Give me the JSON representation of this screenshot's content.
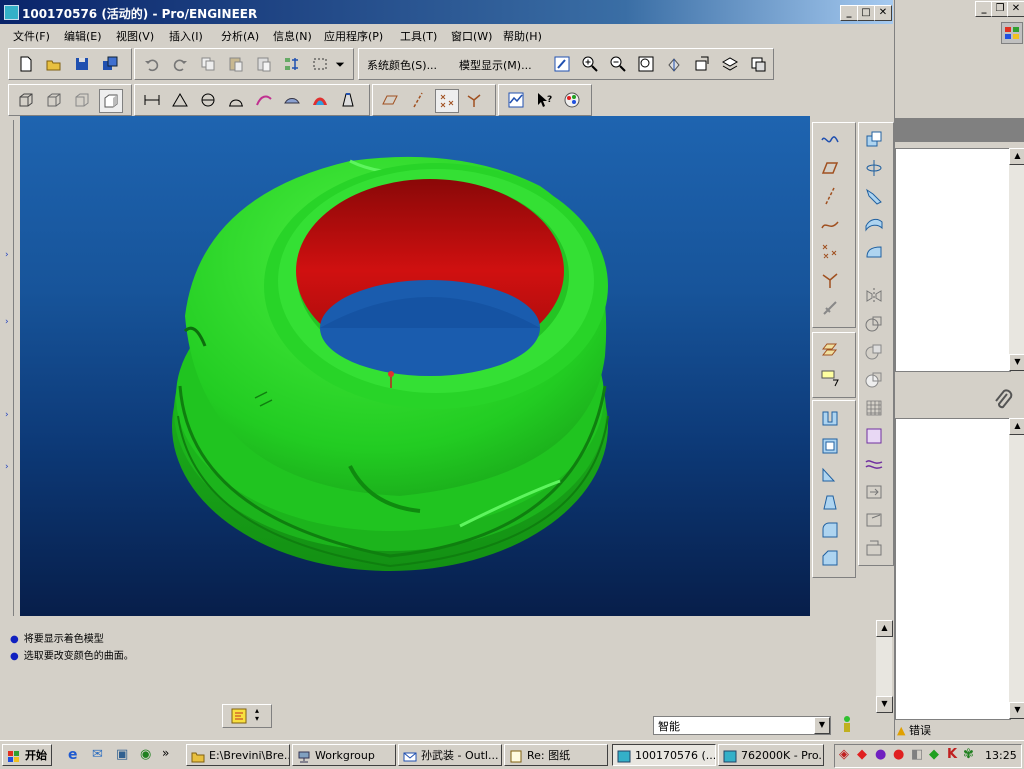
{
  "window": {
    "title": "100170576 (活动的) - Pro/ENGINEER"
  },
  "menu": [
    "文件(F)",
    "编辑(E)",
    "视图(V)",
    "插入(I)",
    "分析(A)",
    "信息(N)",
    "应用程序(P)",
    "工具(T)",
    "窗口(W)",
    "帮助(H)"
  ],
  "toolbar": {
    "system_color_label": "系统颜色(S)...",
    "model_display_label": "模型显示(M)..."
  },
  "messages": [
    "将要显示着色模型",
    "选取要改变颜色的曲面。"
  ],
  "status": {
    "filter_value": "智能"
  },
  "background_window": {
    "error_label": "错误"
  },
  "taskbar": {
    "start_label": "开始",
    "buttons": [
      {
        "label": "E:\\Brevini\\Bre...",
        "active": false
      },
      {
        "label": "Workgroup",
        "active": false
      },
      {
        "label": "孙武装 - Outl...",
        "active": false
      },
      {
        "label": "Re: 图纸",
        "active": false
      },
      {
        "label": "100170576 (...",
        "active": true
      },
      {
        "label": "762000K - Pro...",
        "active": false
      }
    ],
    "clock": "13:25"
  },
  "colors": {
    "model_green": "#22cc22",
    "model_red": "#c01010",
    "titlebar": "#0a246a"
  }
}
